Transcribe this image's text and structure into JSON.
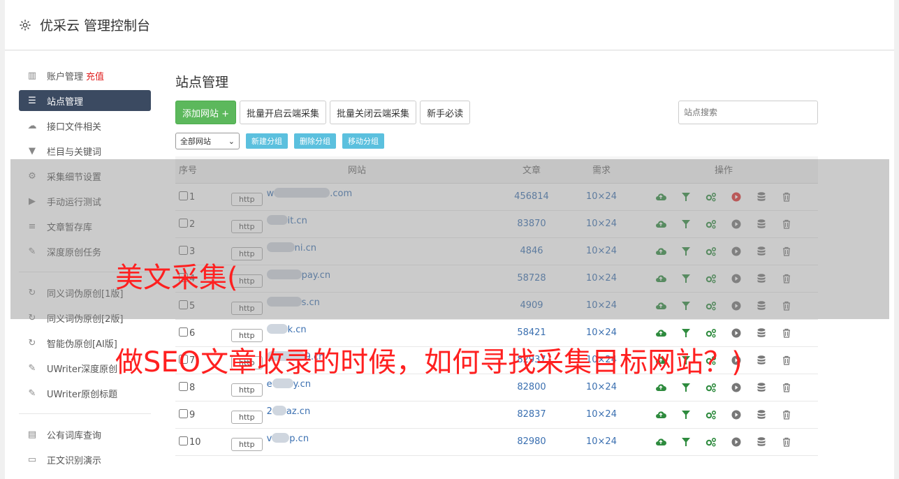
{
  "header": {
    "title": "优采云 管理控制台"
  },
  "sidebar": {
    "items": [
      {
        "label": "账户管理",
        "extra": "充值",
        "icon": "bar-chart-icon"
      },
      {
        "label": "站点管理",
        "icon": "server-icon",
        "active": true
      },
      {
        "label": "接口文件相关",
        "icon": "cloud-upload-icon"
      },
      {
        "label": "栏目与关键词",
        "icon": "filter-icon"
      },
      {
        "label": "采集细节设置",
        "icon": "gears-icon"
      },
      {
        "label": "手动运行测试",
        "icon": "play-circle-icon"
      },
      {
        "label": "文章暂存库",
        "icon": "database-icon"
      },
      {
        "label": "深度原创任务",
        "icon": "edit-icon"
      }
    ],
    "items2": [
      {
        "label": "同义词伪原创[1版]",
        "icon": "refresh-icon"
      },
      {
        "label": "同义词伪原创[2版]",
        "icon": "refresh-icon"
      },
      {
        "label": "智能伪原创[AI版]",
        "icon": "refresh-icon"
      },
      {
        "label": "UWriter深度原创",
        "icon": "edit-icon"
      },
      {
        "label": "UWriter原创标题",
        "icon": "edit-icon"
      }
    ],
    "items3": [
      {
        "label": "公有词库查询",
        "icon": "book-icon"
      },
      {
        "label": "正文识别演示",
        "icon": "monitor-icon"
      }
    ]
  },
  "main": {
    "title": "站点管理",
    "buttons": {
      "add": "添加网站 +",
      "batch_open": "批量开启云端采集",
      "batch_close": "批量关闭云端采集",
      "guide": "新手必读"
    },
    "search_placeholder": "站点搜索",
    "group_select": "全部网站",
    "group_buttons": {
      "new": "新建分组",
      "delete": "删除分组",
      "move": "移动分组"
    },
    "table": {
      "headers": [
        "序号",
        "网站",
        "文章",
        "需求",
        "操作"
      ],
      "rows": [
        {
          "no": "1",
          "proto": "http",
          "domain_prefix": "w",
          "domain": ".com",
          "articles": "456814",
          "demand": "10×24",
          "active": true
        },
        {
          "no": "2",
          "proto": "http",
          "domain_prefix": "",
          "domain": "it.cn",
          "articles": "83870",
          "demand": "10×24",
          "active": false
        },
        {
          "no": "3",
          "proto": "http",
          "domain_prefix": "",
          "domain": "ni.cn",
          "articles": "4846",
          "demand": "10×24",
          "active": false
        },
        {
          "no": "4",
          "proto": "http",
          "domain_prefix": "",
          "domain": "pay.cn",
          "articles": "58728",
          "demand": "10×24",
          "active": false
        },
        {
          "no": "5",
          "proto": "http",
          "domain_prefix": "",
          "domain": "s.cn",
          "articles": "4909",
          "demand": "10×24",
          "active": false
        },
        {
          "no": "6",
          "proto": "http",
          "domain_prefix": "",
          "domain": "k.cn",
          "articles": "58421",
          "demand": "10×24",
          "active": false
        },
        {
          "no": "7",
          "proto": "http",
          "domain_prefix": "",
          "domain": "9.cn",
          "articles": "82937",
          "demand": "10×24",
          "active": false
        },
        {
          "no": "8",
          "proto": "http",
          "domain_prefix": "e",
          "domain": "y.cn",
          "articles": "82800",
          "demand": "10×24",
          "active": false
        },
        {
          "no": "9",
          "proto": "http",
          "domain_prefix": "2",
          "domain": "az.cn",
          "articles": "82837",
          "demand": "10×24",
          "active": false
        },
        {
          "no": "10",
          "proto": "http",
          "domain_prefix": "v",
          "domain": "p.cn",
          "articles": "82980",
          "demand": "10×24",
          "active": false
        }
      ]
    }
  },
  "overlay": {
    "line1": "美文采集(",
    "line2": "做SEO文章收录的时候，如何寻找采集目标网站？)"
  },
  "colors": {
    "green": "#5cb85c",
    "info": "#5bc0de",
    "nav_active": "#3b4a61",
    "link": "#3a6fb0",
    "red": "#ff2020"
  }
}
